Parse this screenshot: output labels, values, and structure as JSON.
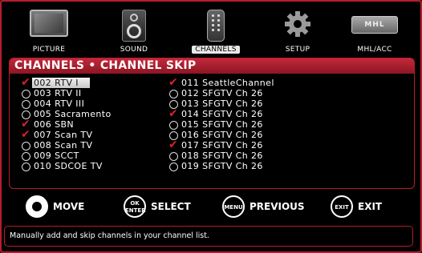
{
  "tabs": [
    {
      "label": "PICTURE",
      "icon": "tv-icon"
    },
    {
      "label": "SOUND",
      "icon": "speaker-icon"
    },
    {
      "label": "CHANNELS",
      "icon": "remote-icon",
      "active": true
    },
    {
      "label": "SETUP",
      "icon": "gear-icon"
    },
    {
      "label": "MHL/ACC",
      "icon": "mhl-icon",
      "badge": "MHL"
    }
  ],
  "panel": {
    "title": "CHANNELS • CHANNEL SKIP"
  },
  "channels_left": [
    {
      "label": "002 RTV I",
      "checked": true,
      "selected": true
    },
    {
      "label": "003 RTV II",
      "checked": false
    },
    {
      "label": "004 RTV III",
      "checked": false
    },
    {
      "label": "005 Sacramento",
      "checked": false
    },
    {
      "label": "006 SBN",
      "checked": true
    },
    {
      "label": "007 Scan TV",
      "checked": true
    },
    {
      "label": "008 Scan TV",
      "checked": false
    },
    {
      "label": "009 SCCT",
      "checked": false
    },
    {
      "label": "010 SDCOE TV",
      "checked": false
    }
  ],
  "channels_right": [
    {
      "label": "011 SeattleChannel",
      "checked": true
    },
    {
      "label": "012 SFGTV Ch 26",
      "checked": false
    },
    {
      "label": "013 SFGTV Ch 26",
      "checked": false
    },
    {
      "label": "014 SFGTV Ch 26",
      "checked": true
    },
    {
      "label": "015 SFGTV Ch 26",
      "checked": false
    },
    {
      "label": "016 SFGTV Ch 26",
      "checked": false
    },
    {
      "label": "017 SFGTV Ch 26",
      "checked": true
    },
    {
      "label": "018 SFGTV Ch 26",
      "checked": false
    },
    {
      "label": "019 SFGTV Ch 26",
      "checked": false
    }
  ],
  "controls": {
    "move": {
      "label": "MOVE"
    },
    "select": {
      "button": "OK\nENTER",
      "label": "SELECT"
    },
    "previous": {
      "button": "MENU",
      "label": "PREVIOUS"
    },
    "exit": {
      "button": "EXIT",
      "label": "EXIT"
    }
  },
  "help_text": "Manually add and skip channels in your channel list.",
  "colors": {
    "accent": "#b71c2c",
    "check": "#d2232a",
    "selection": "#e9e9e9"
  }
}
